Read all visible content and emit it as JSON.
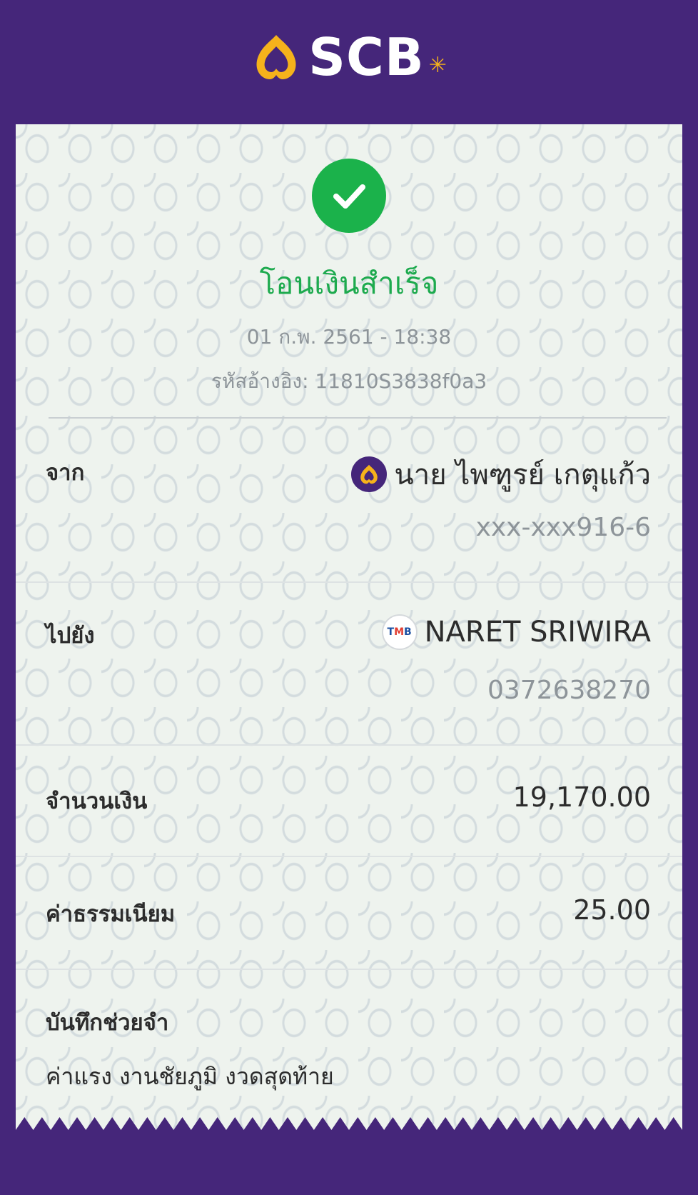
{
  "header": {
    "brand_text": "SCB",
    "brand_star": "✳"
  },
  "receipt": {
    "status_icon": "check-circle-icon",
    "status_text": "โอนเงินสำเร็จ",
    "datetime": "01 ก.พ. 2561 - 18:38",
    "reference": "รหัสอ้างอิง: 11810S3838f0a3",
    "from": {
      "label": "จาก",
      "bank_icon": "scb-bank-icon",
      "name": "นาย ไพฑูรย์ เกตุแก้ว",
      "account": "xxx-xxx916-6"
    },
    "to": {
      "label": "ไปยัง",
      "bank_icon": "tmb-bank-icon",
      "bank_badge": [
        "T",
        "M",
        "B"
      ],
      "name": "NARET SRIWIRA",
      "account": "0372638270"
    },
    "amount": {
      "label": "จำนวนเงิน",
      "value": "19,170.00"
    },
    "fee": {
      "label": "ค่าธรรมเนียม",
      "value": "25.00"
    },
    "memo": {
      "label": "บันทึกช่วยจำ",
      "value": "ค่าแรง งานชัยภูมิ งวดสุดท้าย"
    }
  },
  "colors": {
    "brand_purple": "#45267a",
    "brand_gold": "#f5b21b",
    "success_green": "#1bb24b",
    "muted_text": "#8d9499"
  }
}
